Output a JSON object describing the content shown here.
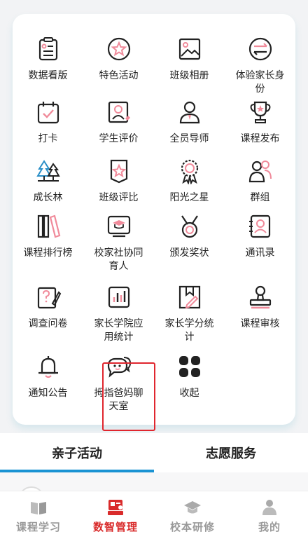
{
  "grid": {
    "items": [
      {
        "label": "数据看版",
        "icon": "dashboard-board-icon"
      },
      {
        "label": "特色活动",
        "icon": "star-badge-icon"
      },
      {
        "label": "班级相册",
        "icon": "photo-album-icon"
      },
      {
        "label": "体验家长身份",
        "icon": "switch-role-icon"
      },
      {
        "label": "打卡",
        "icon": "calendar-check-icon"
      },
      {
        "label": "学生评价",
        "icon": "student-review-icon"
      },
      {
        "label": "全员导师",
        "icon": "mentor-icon"
      },
      {
        "label": "课程发布",
        "icon": "trophy-icon"
      },
      {
        "label": "成长林",
        "icon": "forest-icon"
      },
      {
        "label": "班级评比",
        "icon": "ribbon-star-icon"
      },
      {
        "label": "阳光之星",
        "icon": "sun-medal-icon"
      },
      {
        "label": "群组",
        "icon": "group-icon"
      },
      {
        "label": "课程排行榜",
        "icon": "books-ranking-icon"
      },
      {
        "label": "校家社协同育人",
        "icon": "graduation-cap-screen-icon"
      },
      {
        "label": "颁发奖状",
        "icon": "medal-icon"
      },
      {
        "label": "通讯录",
        "icon": "contact-card-icon"
      },
      {
        "label": "调查问卷",
        "icon": "questionnaire-icon"
      },
      {
        "label": "家长学院应用统计",
        "icon": "bar-stats-icon"
      },
      {
        "label": "家长学分统计",
        "icon": "credit-pencil-icon"
      },
      {
        "label": "课程审核",
        "icon": "stamp-icon"
      },
      {
        "label": "通知公告",
        "icon": "bell-icon"
      },
      {
        "label": "拇指爸妈聊天室",
        "icon": "chat-bubbles-icon"
      },
      {
        "label": "收起",
        "icon": "collapse-grid-icon"
      }
    ]
  },
  "tabs": [
    {
      "label": "亲子活动",
      "active": true
    },
    {
      "label": "志愿服务",
      "active": false
    }
  ],
  "bottom_nav": [
    {
      "label": "课程学习",
      "icon": "book-icon",
      "active": false
    },
    {
      "label": "数智管理",
      "icon": "management-icon",
      "active": true
    },
    {
      "label": "校本研修",
      "icon": "graduation-cap-icon",
      "active": false
    },
    {
      "label": "我的",
      "icon": "person-icon",
      "active": false
    }
  ],
  "colors": {
    "accent_red": "#e0262e",
    "tab_blue": "#1a93d3",
    "icon_dark": "#222222",
    "icon_pink": "#f08a9a"
  }
}
